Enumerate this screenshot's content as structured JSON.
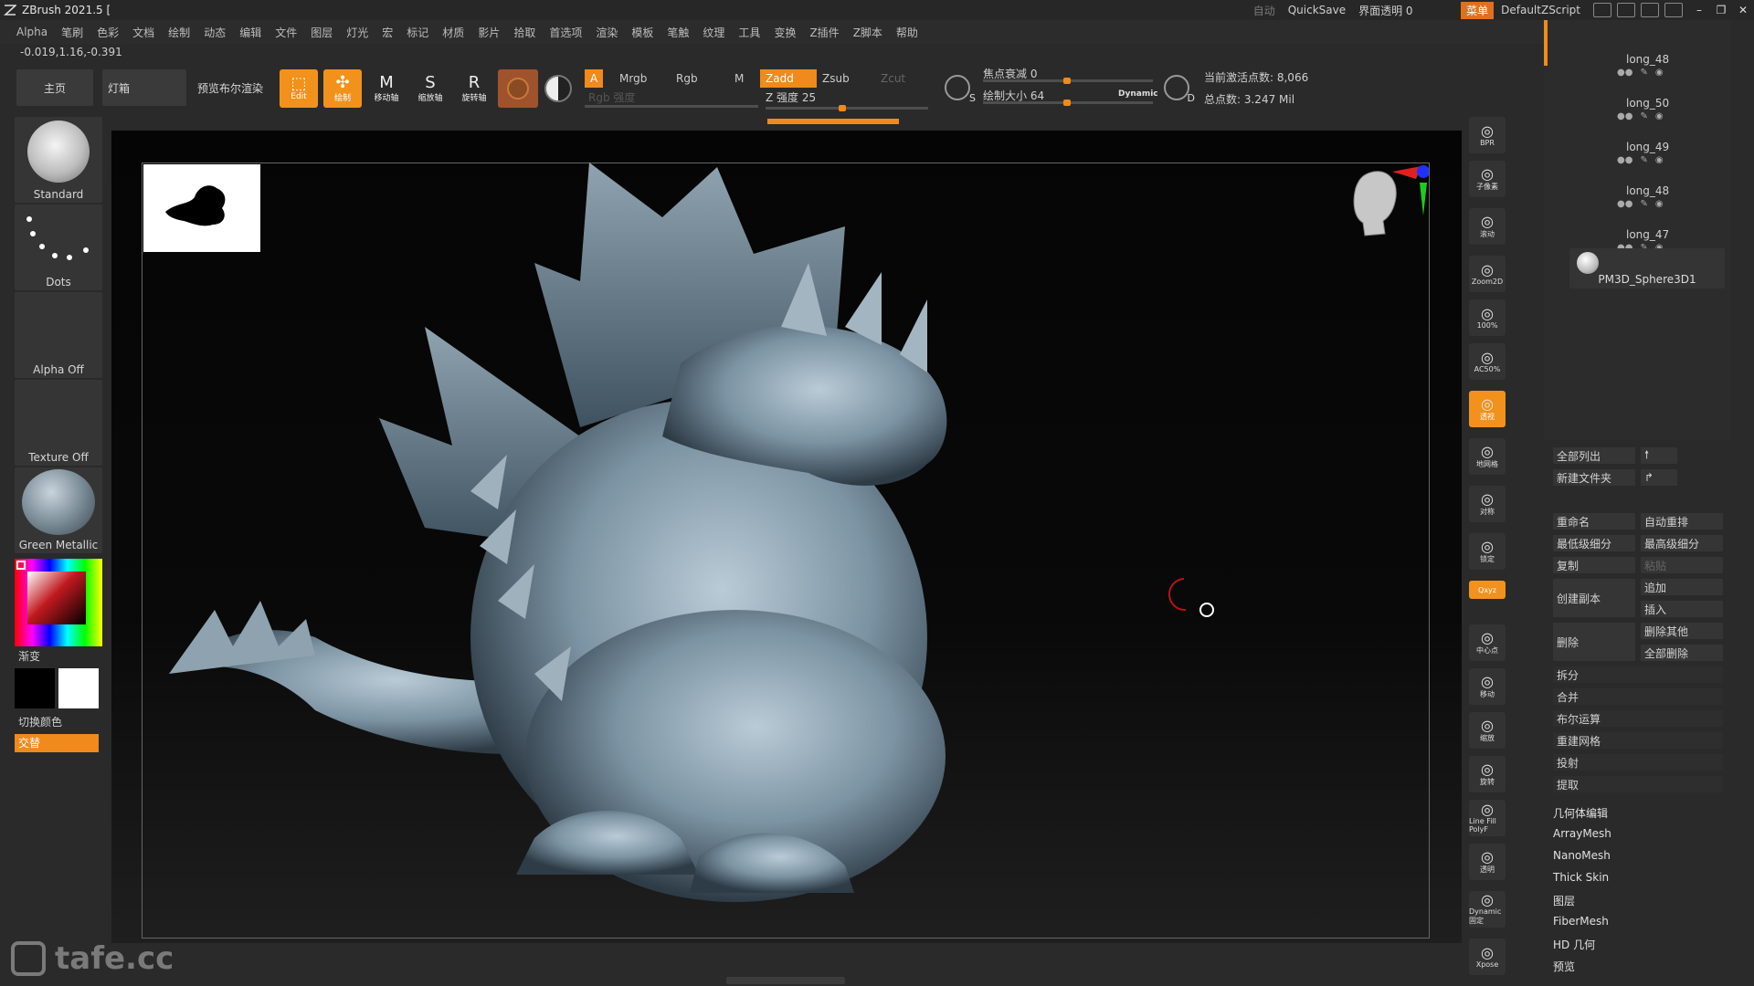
{
  "title": "ZBrush 2021.5 [",
  "titlebar": {
    "auto": "自动",
    "quicksave": "QuickSave",
    "transparency": "界面透明 0",
    "menu": "菜单",
    "script": "DefaultZScript"
  },
  "menu": [
    "Alpha",
    "笔刷",
    "色彩",
    "文档",
    "绘制",
    "动态",
    "编辑",
    "文件",
    "图层",
    "灯光",
    "宏",
    "标记",
    "材质",
    "影片",
    "拾取",
    "首选项",
    "渲染",
    "模板",
    "笔触",
    "纹理",
    "工具",
    "变换",
    "Z插件",
    "Z脚本",
    "帮助"
  ],
  "coords": "-0.019,1.16,-0.391",
  "toolbar": {
    "home": "主页",
    "lightbox": "灯箱",
    "bpr": "预览布尔渲染",
    "edit": "Edit",
    "draw": "绘制",
    "move": "移动轴",
    "scale": "缩放轴",
    "rotate": "旋转轴",
    "a_btn": "A",
    "mrgb": "Mrgb",
    "rgb": "Rgb",
    "m": "M",
    "zadd": "Zadd",
    "zsub": "Zsub",
    "zcut": "Zcut",
    "rgb_intensity": "Rgb 强度",
    "z_intensity": "Z 强度 25",
    "z_intensity_value": 25,
    "focal_shift": "焦点衰减 0",
    "draw_size": "绘制大小 64",
    "draw_size_value": 64,
    "dynamic": "Dynamic",
    "active_points": "当前激活点数: 8,066",
    "total_points": "总点数: 3.247 Mil",
    "s_label": "S",
    "d_label": "D"
  },
  "left": {
    "brush": "Standard",
    "stroke": "Dots",
    "alpha": "Alpha Off",
    "texture": "Texture Off",
    "material": "Green Metallic",
    "gradient": "渐变",
    "switch_color": "切换颜色",
    "alternate": "交替",
    "colors": {
      "primary": "#000000",
      "secondary": "#ffffff",
      "accent": "#f08a1c"
    }
  },
  "right_toolbar": [
    {
      "name": "bpr",
      "label": "BPR"
    },
    {
      "name": "subpixel",
      "label": "子像素"
    },
    {
      "name": "scroll",
      "label": "滚动"
    },
    {
      "name": "zoom2d",
      "label": "Zoom2D"
    },
    {
      "name": "zoom100",
      "label": "100%"
    },
    {
      "name": "zoomac50",
      "label": "AC50%"
    },
    {
      "name": "persp",
      "label": "透视"
    },
    {
      "name": "floor",
      "label": "地网格"
    },
    {
      "name": "local",
      "label": "对称"
    },
    {
      "name": "lock",
      "label": "锁定"
    },
    {
      "name": "xyz",
      "label": "Qxyz"
    },
    {
      "name": "frame",
      "label": "中心点"
    },
    {
      "name": "move",
      "label": "移动"
    },
    {
      "name": "scale",
      "label": "缩放"
    },
    {
      "name": "rotate",
      "label": "旋转"
    },
    {
      "name": "linefill",
      "label": "Line Fill PolyF"
    },
    {
      "name": "transp",
      "label": "透明"
    },
    {
      "name": "ghost",
      "label": "Dynamic 固定"
    },
    {
      "name": "xpose",
      "label": "Xpose"
    }
  ],
  "subtools": [
    "long_48",
    "long_50",
    "long_49",
    "long_48",
    "long_47"
  ],
  "active_subtool": "PM3D_Sphere3D1",
  "subtool_panel": {
    "list_all": "全部列出",
    "new_folder": "新建文件夹",
    "rename": "重命名",
    "auto_reorder": "自动重排",
    "lowest_sub": "最低级细分",
    "highest_sub": "最高级细分",
    "copy": "复制",
    "paste": "粘贴",
    "duplicate": "创建副本",
    "append": "追加",
    "insert": "插入",
    "delete": "删除",
    "delete_other": "删除其他",
    "delete_all": "全部删除",
    "split": "拆分",
    "merge": "合并",
    "boolean": "布尔运算",
    "remesh": "重建网格",
    "project": "投射",
    "extract": "提取"
  },
  "lower_list": [
    "几何体编辑",
    "ArrayMesh",
    "NanoMesh",
    "Thick Skin",
    "图层",
    "FiberMesh",
    "HD 几何",
    "预览"
  ],
  "watermark": "tafe.cc"
}
